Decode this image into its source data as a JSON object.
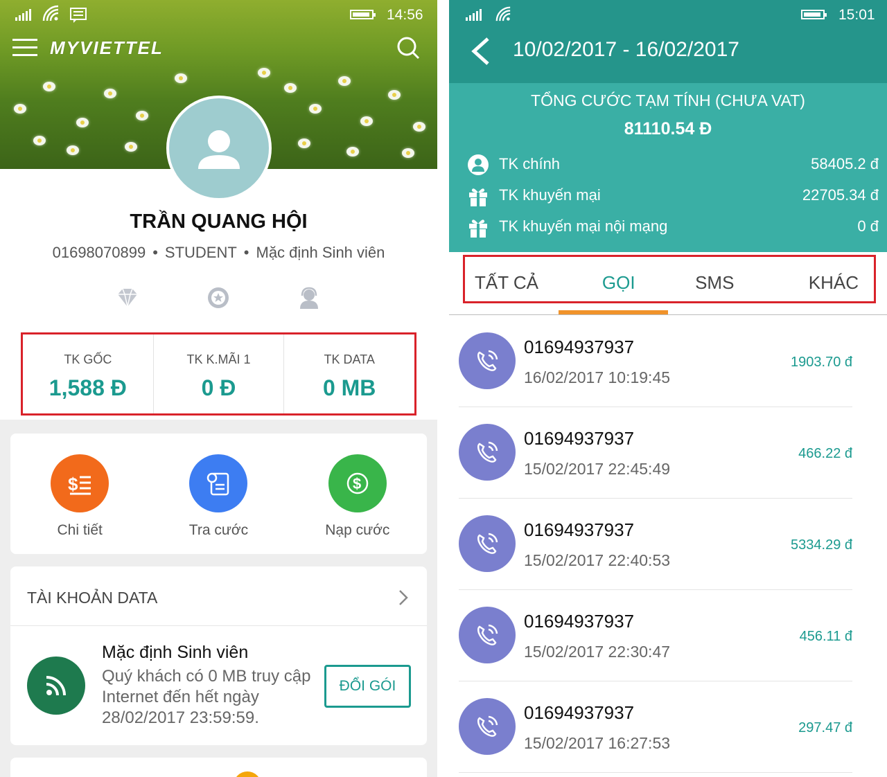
{
  "left": {
    "status": {
      "time": "14:56"
    },
    "brand": "MYVIETTEL",
    "profile": {
      "name": "TRẦN QUANG HỘI",
      "phone": "01698070899",
      "plan_type": "STUDENT",
      "plan_name": "Mặc định Sinh viên"
    },
    "profile_icons": [
      "diamond-icon",
      "star-badge-icon",
      "support-agent-icon"
    ],
    "balances": [
      {
        "label": "TK GỐC",
        "value": "1,588 Đ"
      },
      {
        "label": "TK K.MÃI 1",
        "value": "0 Đ"
      },
      {
        "label": "TK DATA",
        "value": "0 MB"
      }
    ],
    "actions": [
      {
        "label": "Chi tiết",
        "icon": "detail-list-icon",
        "color": "#f26a1b"
      },
      {
        "label": "Tra cước",
        "icon": "bill-lookup-icon",
        "color": "#3d7df2"
      },
      {
        "label": "Nạp cước",
        "icon": "dollar-coin-icon",
        "color": "#39b54a"
      }
    ],
    "data_account": {
      "title": "TÀI KHOẢN DATA",
      "package_name": "Mặc định Sinh viên",
      "description": "Quý khách có 0 MB truy cập Internet đến hết ngày 28/02/2017 23:59:59.",
      "button": "ĐỔI GÓI"
    }
  },
  "right": {
    "status": {
      "time": "15:01"
    },
    "date_range": "10/02/2017 - 16/02/2017",
    "summary": {
      "title": "TỔNG CƯỚC TẠM TÍNH (CHƯA VAT)",
      "total": "81110.54 Đ",
      "accounts": [
        {
          "label": "TK chính",
          "value": "58405.2 đ",
          "icon": "user-circle-icon"
        },
        {
          "label": "TK khuyến mại",
          "value": "22705.34 đ",
          "icon": "gift-icon"
        },
        {
          "label": "TK khuyến mại nội mạng",
          "value": "0 đ",
          "icon": "gift-icon"
        }
      ]
    },
    "tabs": [
      {
        "label": "TẤT CẢ",
        "active": false
      },
      {
        "label": "GỌI",
        "active": true
      },
      {
        "label": "SMS",
        "active": false
      },
      {
        "label": "KHÁC",
        "active": false
      }
    ],
    "calls": [
      {
        "number": "01694937937",
        "time": "16/02/2017 10:19:45",
        "amount": "1903.70 đ"
      },
      {
        "number": "01694937937",
        "time": "15/02/2017 22:45:49",
        "amount": "466.22 đ"
      },
      {
        "number": "01694937937",
        "time": "15/02/2017 22:40:53",
        "amount": "5334.29 đ"
      },
      {
        "number": "01694937937",
        "time": "15/02/2017 22:30:47",
        "amount": "456.11 đ"
      },
      {
        "number": "01694937937",
        "time": "15/02/2017 16:27:53",
        "amount": "297.47 đ"
      }
    ]
  },
  "colors": {
    "teal": "#1b9a8f",
    "header_teal": "#3aafa5",
    "highlight_red": "#d9222a",
    "tab_indicator": "#f0932b",
    "call_icon": "#7a7fce"
  }
}
